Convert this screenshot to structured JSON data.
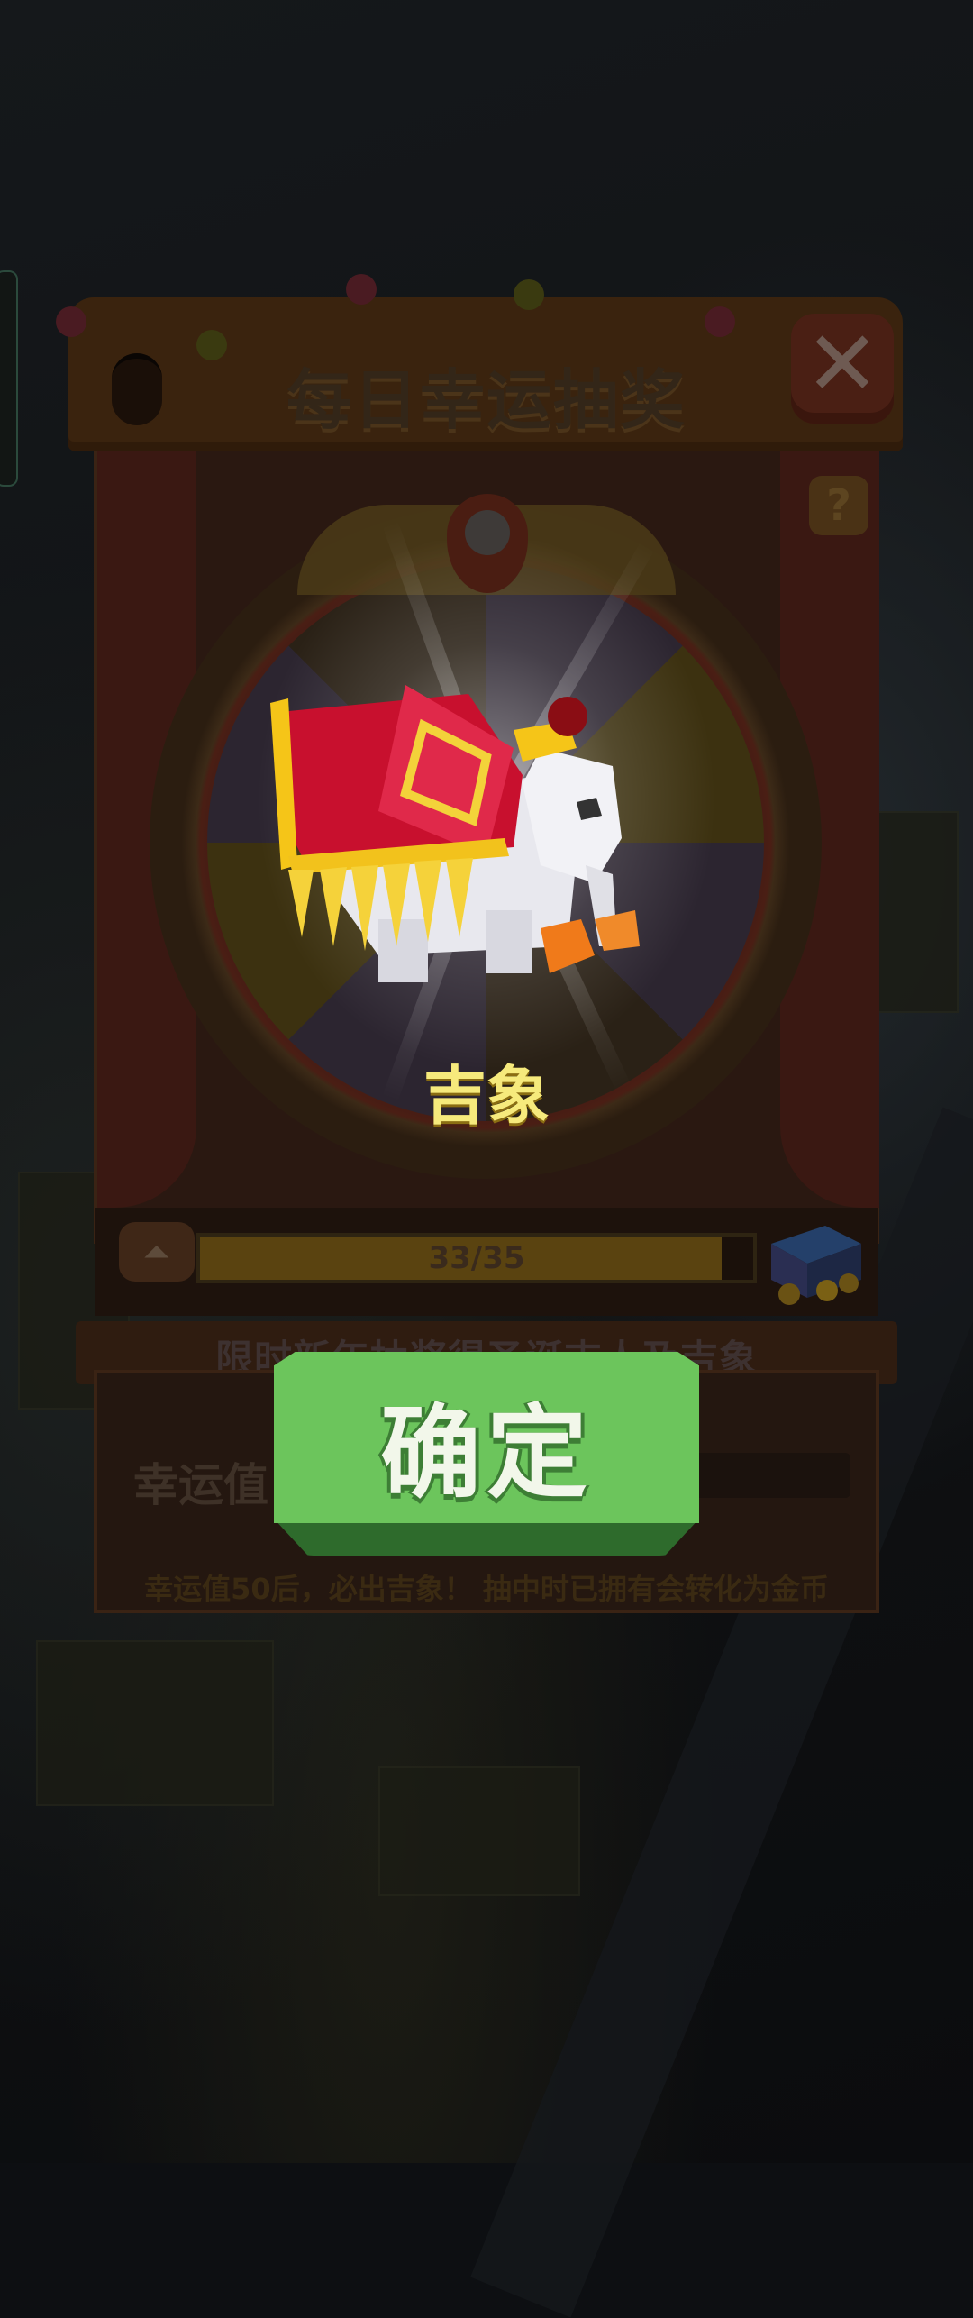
{
  "dialog": {
    "title": "每日幸运抽奖",
    "close_symbol": "✕",
    "help_symbol": "?"
  },
  "wheel": {
    "prize_name": "吉象",
    "prize_icon": "elephant-icon"
  },
  "progress": {
    "text": "33/35",
    "current": 33,
    "total": 35,
    "toggle_symbol": "⏶"
  },
  "banner_text": "限时新年抽奖得圣诞吉人及吉象",
  "luck": {
    "label": "幸运值"
  },
  "footnote": "幸运值50后，必出吉象！ 抽中时已拥有会转化为金币",
  "confirm_button": {
    "label": "确定",
    "color": "#6cc55c"
  }
}
